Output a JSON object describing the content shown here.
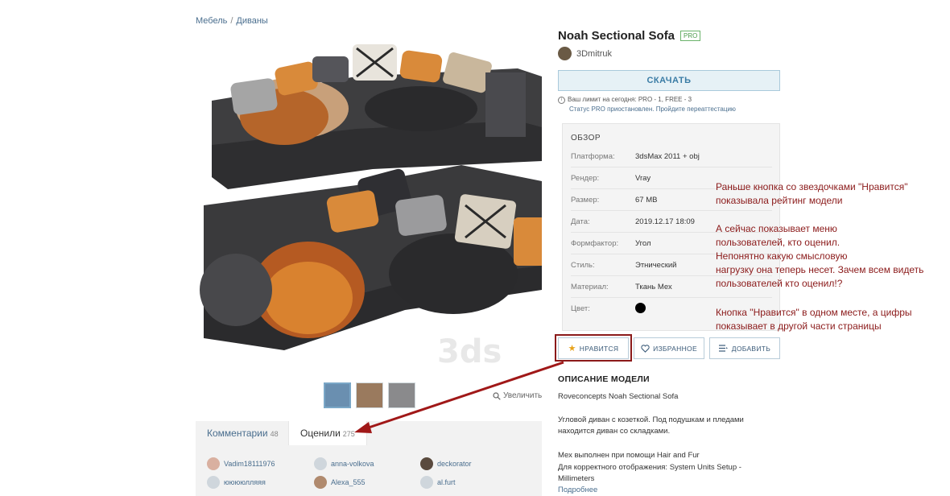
{
  "breadcrumb": {
    "item1": "Мебель",
    "sep": "/",
    "item2": "Диваны"
  },
  "product": {
    "title": "Noah Sectional Sofa",
    "badge": "PRO",
    "author": "3Dmitruk",
    "watermark": "3ds"
  },
  "download": {
    "label": "СКАЧАТЬ",
    "limit_line1": "Ваш лимит на сегодня: PRO - 1, FREE - 3",
    "limit_line2": "Статус PRO приостановлен. Пройдите переаттестацию"
  },
  "overview": {
    "heading": "ОБЗОР",
    "rows": [
      {
        "key": "Платформа:",
        "value": "3dsMax 2011 + obj"
      },
      {
        "key": "Рендер:",
        "value": "Vray"
      },
      {
        "key": "Размер:",
        "value": "67 MB"
      },
      {
        "key": "Дата:",
        "value": "2019.12.17 18:09"
      },
      {
        "key": "Формфактор:",
        "value": "Угол"
      },
      {
        "key": "Стиль:",
        "value": "Этнический"
      },
      {
        "key": "Материал:",
        "value": "Ткань Мех"
      },
      {
        "key": "Цвет:",
        "value": ""
      }
    ],
    "color_value": "#000000"
  },
  "actions": {
    "like": "НРАВИТСЯ",
    "favorite": "ИЗБРАННОЕ",
    "add": "ДОБАВИТЬ"
  },
  "description": {
    "heading": "ОПИСАНИЕ МОДЕЛИ",
    "line1": "Roveconcepts Noah Sectional Sofa",
    "line2": "Угловой диван с козеткой. Под подушкам и пледами",
    "line3": "находится диван со складками.",
    "line4": "Мех выполнен при помощи Hair and Fur",
    "line5": "Для корректного отображения: System Units Setup -",
    "line6": "Millimeters",
    "more": "Подробнее"
  },
  "gallery": {
    "zoom": "Увеличить"
  },
  "tabs": {
    "comments": "Комментарии",
    "comments_count": "48",
    "rated": "Оценили",
    "rated_count": "275"
  },
  "raters": [
    "Vadim18111976",
    "anna-volkova",
    "deckorator",
    "ююююлляяя",
    "Alexa_555",
    "al.furt"
  ],
  "annotation": {
    "p1": "Раньше кнопка со звездочками \"Нравится\"\nпоказывала рейтинг модели",
    "p2": "А сейчас показывает меню\nпользователей, кто оценил.\nНепонятно какую смысловую\nнагрузку она теперь несет. Зачем всем видеть\nпользователей кто оценил!?",
    "p3": "Кнопка \"Нравится\" в одном месте, а цифры\nпоказывает в другой части страницы"
  },
  "colors": {
    "annotation": "#8b1a1a",
    "link": "#4a6e8e",
    "accent": "#3a7ca5"
  }
}
